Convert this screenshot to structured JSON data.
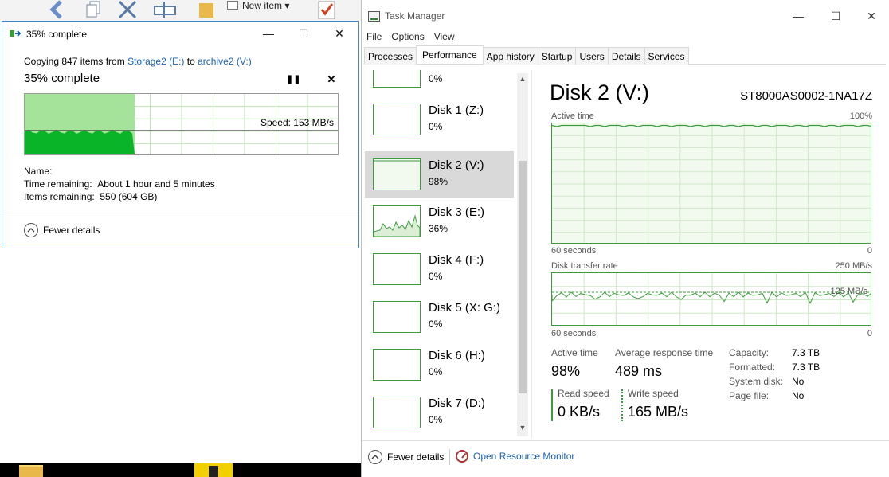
{
  "explorer": {
    "new_item_label": "New item ▾",
    "select_all_label": "Select all"
  },
  "copy_dialog": {
    "title": "35% complete",
    "copying_prefix": "Copying 847 items from ",
    "source": "Storage2 (E:)",
    "to": " to ",
    "destination": "archive2 (V:)",
    "percent_label": "35% complete",
    "progress_fraction": 0.35,
    "speed_label": "Speed: 153 MB/s",
    "name_label": "Name:",
    "time_remaining_label": "Time remaining:",
    "time_remaining_value": "About 1 hour and 5 minutes",
    "items_remaining_label": "Items remaining:",
    "items_remaining_value": "550 (604 GB)",
    "fewer_details": "Fewer details",
    "colors": {
      "fill_dark": "#0ab429",
      "fill_light": "#a6e39a",
      "grid": "#bfe3b6"
    }
  },
  "taskmgr": {
    "title": "Task Manager",
    "menu": [
      "File",
      "Options",
      "View"
    ],
    "tabs": [
      "Processes",
      "Performance",
      "App history",
      "Startup",
      "Users",
      "Details",
      "Services"
    ],
    "active_tab": "Performance",
    "disks": [
      {
        "name": "",
        "pct": "0%"
      },
      {
        "name": "Disk 1 (Z:)",
        "pct": "0%"
      },
      {
        "name": "Disk 2 (V:)",
        "pct": "98%",
        "selected": true
      },
      {
        "name": "Disk 3 (E:)",
        "pct": "36%"
      },
      {
        "name": "Disk 4 (F:)",
        "pct": "0%"
      },
      {
        "name": "Disk 5 (X: G:)",
        "pct": "0%"
      },
      {
        "name": "Disk 6 (H:)",
        "pct": "0%"
      },
      {
        "name": "Disk 7 (D:)",
        "pct": "0%"
      }
    ],
    "detail": {
      "title": "Disk 2 (V:)",
      "model": "ST8000AS0002-1NA17Z",
      "active_time_label": "Active time",
      "active_time_max": "100%",
      "seconds_label": "60 seconds",
      "zero": "0",
      "transfer_label": "Disk transfer rate",
      "transfer_max": "250 MB/s",
      "transfer_mid": "125 MB/s",
      "stats": {
        "active_time_label": "Active time",
        "active_time_value": "98%",
        "avg_response_label": "Average response time",
        "avg_response_value": "489 ms",
        "read_label": "Read speed",
        "read_value": "0 KB/s",
        "write_label": "Write speed",
        "write_value": "165 MB/s"
      },
      "info": [
        {
          "label": "Capacity:",
          "value": "7.3 TB"
        },
        {
          "label": "Formatted:",
          "value": "7.3 TB"
        },
        {
          "label": "System disk:",
          "value": "No"
        },
        {
          "label": "Page file:",
          "value": "No"
        }
      ]
    },
    "footer": {
      "fewer_details": "Fewer details",
      "open_resource_monitor": "Open Resource Monitor"
    },
    "colors": {
      "accent": "#3c9b3c",
      "graph_fill": "#f2faef",
      "link": "#1a5fb4"
    }
  }
}
